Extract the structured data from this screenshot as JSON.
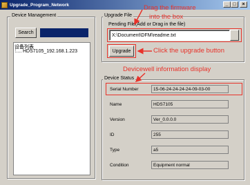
{
  "window": {
    "title": "Upgrade_Program_Network",
    "min": "_",
    "max": "□",
    "close": "×"
  },
  "device_management": {
    "group_title": "Device Management",
    "search_label": "Search",
    "tree_root": "设备列表",
    "tree_items": [
      "HDS7105_192.168.1.223"
    ]
  },
  "upgrade_file": {
    "group_title": "Upgrade File",
    "pending_label": "Pending File(Add or Drag in the file)",
    "path_value": "X:\\Document\\DFM\\readme.txt",
    "upgrade_label": "Upgrade"
  },
  "device_status": {
    "group_title": "Device Status",
    "rows": [
      {
        "label": "Serial Number",
        "value": "15-06-24-24-24-24-09-03-00"
      },
      {
        "label": "Name",
        "value": "HDS7105"
      },
      {
        "label": "Version",
        "value": "Ver_0.0.0.0"
      },
      {
        "label": "ID",
        "value": "255"
      },
      {
        "label": "Type",
        "value": "a5"
      },
      {
        "label": "Condition",
        "value": "Equipment normal"
      }
    ]
  },
  "annotations": {
    "drag_line1": "Drag the firmware",
    "drag_line2": "into the box",
    "click": "Click the upgrade button",
    "info": "Devicewell information display",
    "color": "#e8322a"
  }
}
